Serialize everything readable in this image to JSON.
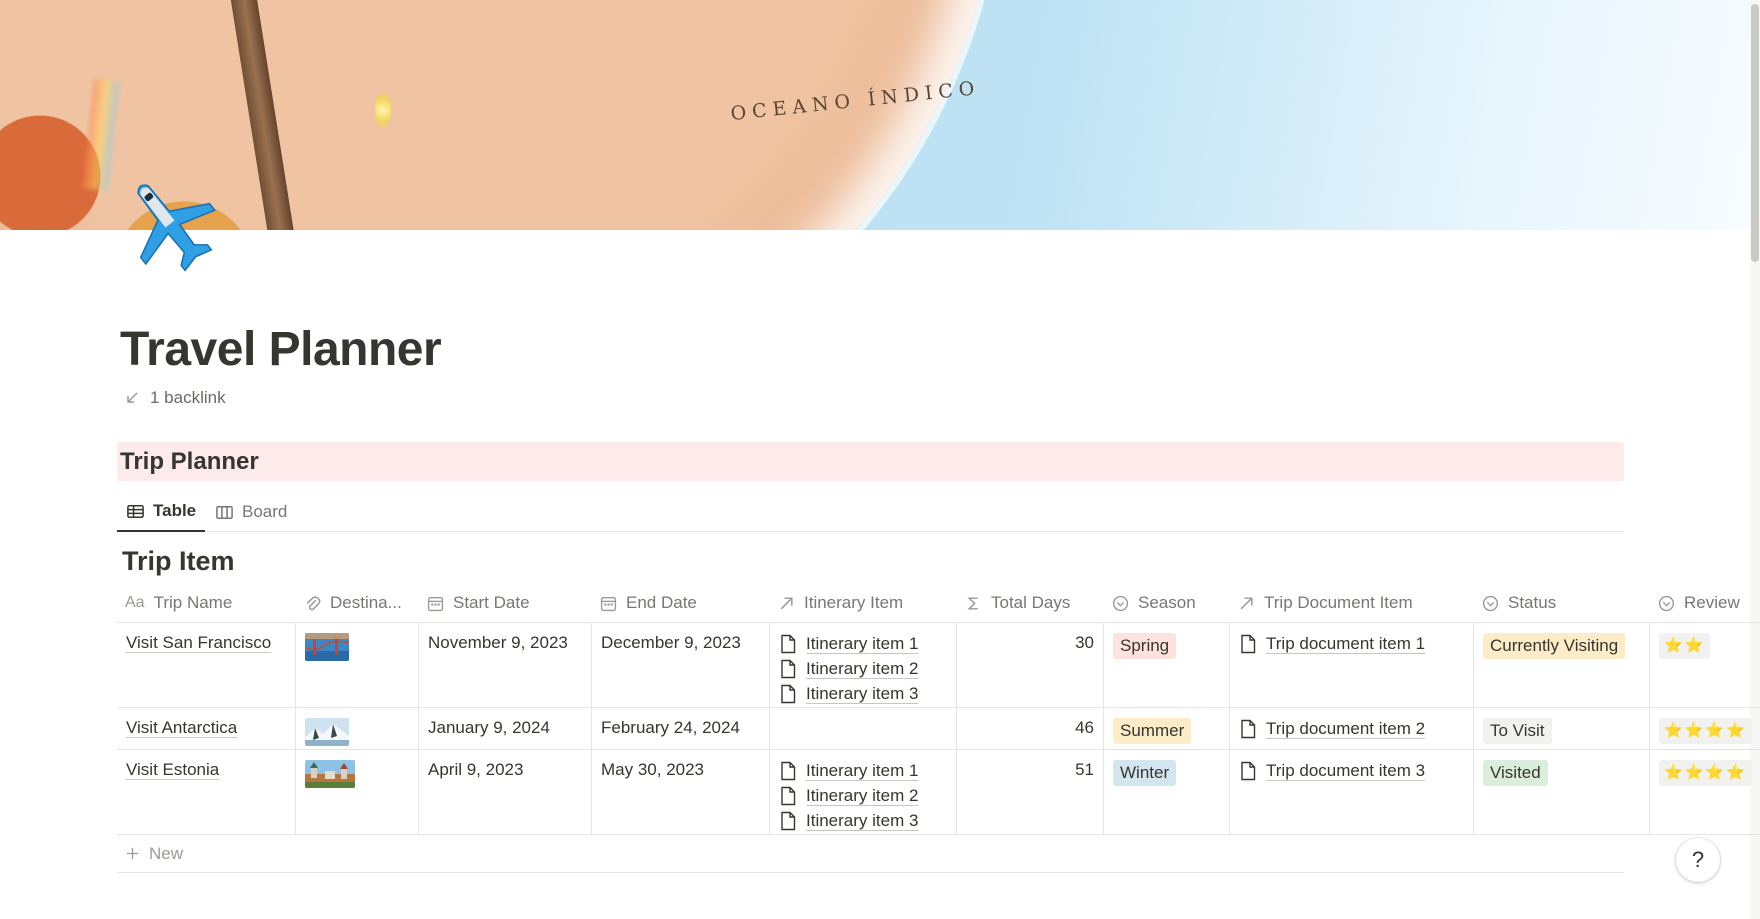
{
  "page": {
    "title": "Travel Planner",
    "backlink": "1 backlink"
  },
  "cover": {
    "ocean_label": "OCEANO ÍNDICO"
  },
  "callout": {
    "text": "Trip Planner"
  },
  "views": {
    "tabs": [
      {
        "label": "Table",
        "active": true
      },
      {
        "label": "Board",
        "active": false
      }
    ]
  },
  "database": {
    "title": "Trip Item",
    "columns": {
      "trip_name": "Trip Name",
      "destination": "Destina...",
      "start_date": "Start Date",
      "end_date": "End Date",
      "itinerary_item": "Itinerary Item",
      "total_days": "Total Days",
      "season": "Season",
      "trip_document_item": "Trip Document Item",
      "status": "Status",
      "review": "Review"
    },
    "rows": [
      {
        "trip_name": "Visit San Francisco",
        "start_date": "November 9, 2023",
        "end_date": "December 9, 2023",
        "itinerary": [
          "Itinerary item 1",
          "Itinerary item 2",
          "Itinerary item 3"
        ],
        "total_days": "30",
        "season": "Spring",
        "trip_document": "Trip document item 1",
        "status": "Currently Visiting",
        "review": "⭐⭐"
      },
      {
        "trip_name": "Visit Antarctica",
        "start_date": "January 9, 2024",
        "end_date": "February 24, 2024",
        "itinerary": [],
        "total_days": "46",
        "season": "Summer",
        "trip_document": "Trip document item 2",
        "status": "To Visit",
        "review": "⭐⭐⭐⭐"
      },
      {
        "trip_name": "Visit Estonia",
        "start_date": "April 9, 2023",
        "end_date": "May 30, 2023",
        "itinerary": [
          "Itinerary item 1",
          "Itinerary item 2",
          "Itinerary item 3"
        ],
        "total_days": "51",
        "season": "Winter",
        "trip_document": "Trip document item 3",
        "status": "Visited",
        "review": "⭐⭐⭐⭐"
      }
    ],
    "new_label": "New"
  },
  "help": {
    "label": "?"
  },
  "colors": {
    "season_spring_bg": "#ffe2dd",
    "season_summer_bg": "#fdecc8",
    "season_winter_bg": "#d3e5ef",
    "status_currently_bg": "#fdecc8",
    "status_tovisit_bg": "#f1f1ef",
    "status_visited_bg": "#dbeddb",
    "callout_bg": "#fdebec"
  }
}
